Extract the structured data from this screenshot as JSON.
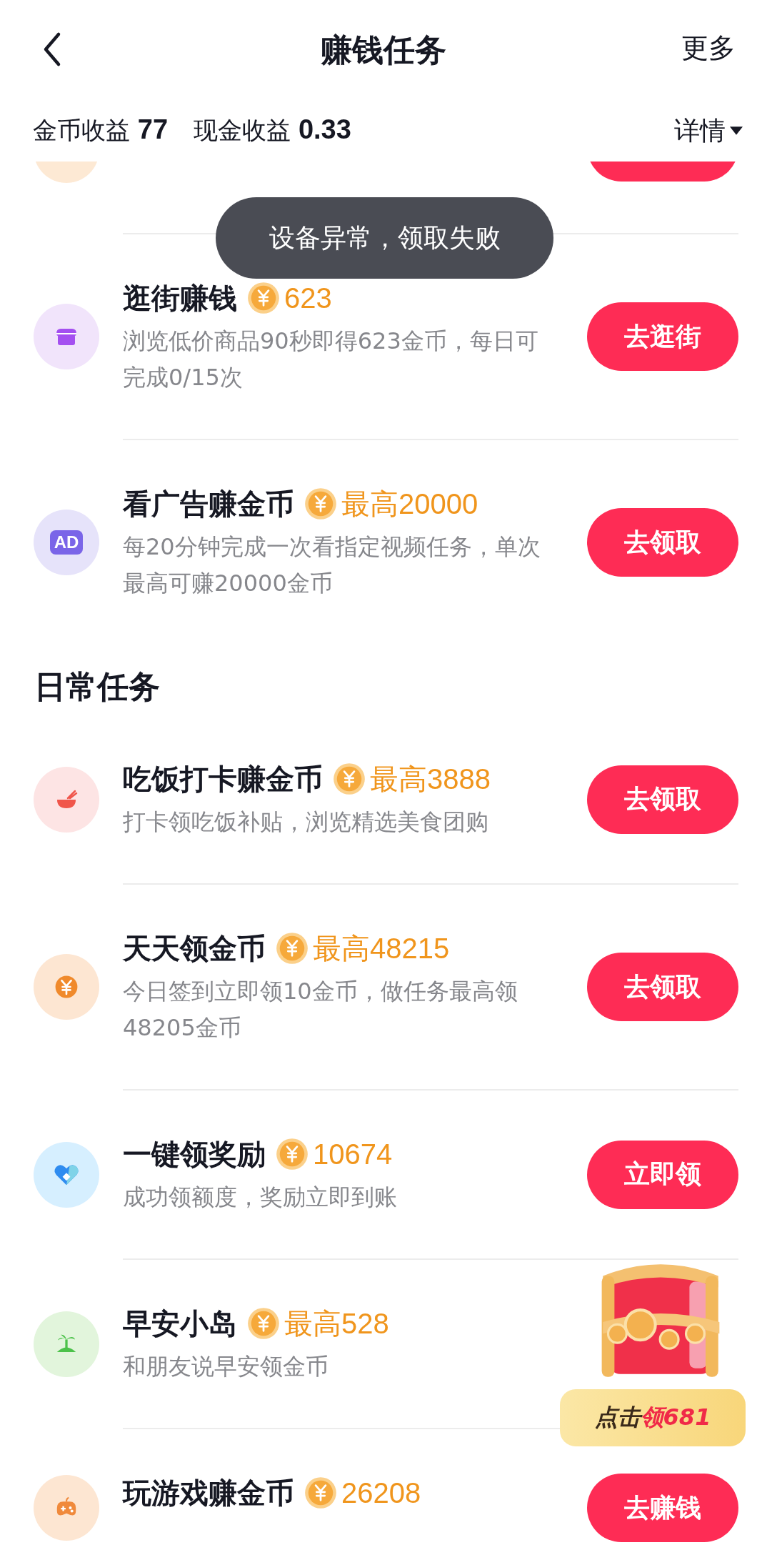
{
  "nav": {
    "title": "赚钱任务",
    "more": "更多"
  },
  "stats": [
    {
      "label": "金币收益",
      "value": "77"
    },
    {
      "label": "现金收益",
      "value": "0.33"
    }
  ],
  "details": "详情",
  "toast": "设备异常，领取失败",
  "sections": [
    {
      "tasks": [
        {
          "kind": "store",
          "title": "逛街赚钱",
          "reward": "623",
          "description": "浏览低价商品90秒即得623金币，每日可完成0/15次",
          "button": "去逛街"
        },
        {
          "kind": "ad",
          "icon_label": "AD",
          "title": "看广告赚金币",
          "reward": "最高20000",
          "description": "每20分钟完成一次看指定视频任务，单次最高可赚20000金币",
          "button": "去领取"
        }
      ]
    },
    {
      "heading": "日常任务",
      "tasks": [
        {
          "kind": "bowl",
          "title": "吃饭打卡赚金币",
          "reward": "最高3888",
          "description": "打卡领吃饭补贴，浏览精选美食团购",
          "button": "去领取"
        },
        {
          "kind": "yen",
          "title": "天天领金币",
          "reward": "最高48215",
          "description": "今日签到立即领10金币，做任务最高领48205金币",
          "button": "去领取"
        },
        {
          "kind": "heart",
          "title": "一键领奖励",
          "reward": "10674",
          "description": "成功领额度，奖励立即到账",
          "button": "立即领"
        },
        {
          "kind": "island",
          "title": "早安小岛",
          "reward": "最高528",
          "description": "和朋友说早安领金币"
        },
        {
          "kind": "game",
          "title": "玩游戏赚金币",
          "reward": "26208",
          "button": "去赚钱"
        }
      ]
    }
  ],
  "chest": {
    "prefix": "点击",
    "highlight": "领681"
  }
}
